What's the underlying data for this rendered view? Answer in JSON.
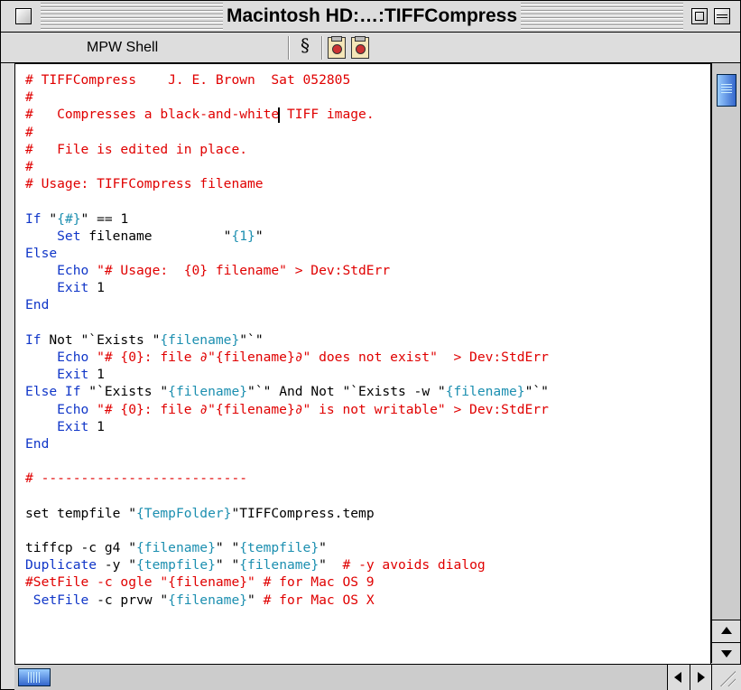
{
  "window": {
    "title": "Macintosh HD:…:TIFFCompress"
  },
  "infobar": {
    "shell_label": "MPW Shell",
    "section_glyph": "§",
    "icons": [
      "script-tool-icon",
      "script-tool-icon"
    ]
  },
  "colors": {
    "comment": "#e00000",
    "keyword": "#1036c8",
    "variable": "#1c8fb0",
    "text": "#000000",
    "scroll_thumb": "#3366cc"
  },
  "code_lines": [
    [
      [
        "c-red",
        "# TIFFCompress    J. E. Brown  Sat 052805"
      ]
    ],
    [
      [
        "c-red",
        "#"
      ]
    ],
    [
      [
        "c-red",
        "#   Compresses a black-and-white"
      ],
      [
        "caret",
        ""
      ],
      [
        "c-red",
        " TIFF image."
      ]
    ],
    [
      [
        "c-red",
        "#"
      ]
    ],
    [
      [
        "c-red",
        "#   File is edited in place."
      ]
    ],
    [
      [
        "c-red",
        "#"
      ]
    ],
    [
      [
        "c-red",
        "# Usage: TIFFCompress filename"
      ]
    ],
    [],
    [
      [
        "c-blue",
        "If "
      ],
      [
        "c-black",
        "\""
      ],
      [
        "c-teal",
        "{#}"
      ],
      [
        "c-black",
        "\" == 1"
      ]
    ],
    [
      [
        "c-blue",
        "    Set "
      ],
      [
        "c-black",
        "filename         \""
      ],
      [
        "c-teal",
        "{1}"
      ],
      [
        "c-black",
        "\""
      ]
    ],
    [
      [
        "c-blue",
        "Else"
      ]
    ],
    [
      [
        "c-blue",
        "    Echo "
      ],
      [
        "c-red",
        "\"# Usage:  {0} filename\" > Dev:StdErr"
      ]
    ],
    [
      [
        "c-blue",
        "    Exit "
      ],
      [
        "c-black",
        "1"
      ]
    ],
    [
      [
        "c-blue",
        "End"
      ]
    ],
    [],
    [
      [
        "c-blue",
        "If "
      ],
      [
        "c-black",
        "Not \"`Exists \""
      ],
      [
        "c-teal",
        "{filename}"
      ],
      [
        "c-black",
        "\"`\""
      ]
    ],
    [
      [
        "c-blue",
        "    Echo "
      ],
      [
        "c-red",
        "\"# {0}: file ∂\"{filename}∂\" does not exist\"  > Dev:StdErr"
      ]
    ],
    [
      [
        "c-blue",
        "    Exit "
      ],
      [
        "c-black",
        "1"
      ]
    ],
    [
      [
        "c-blue",
        "Else If "
      ],
      [
        "c-black",
        "\"`Exists \""
      ],
      [
        "c-teal",
        "{filename}"
      ],
      [
        "c-black",
        "\"`\" And Not \"`Exists -w \""
      ],
      [
        "c-teal",
        "{filename}"
      ],
      [
        "c-black",
        "\"`\""
      ]
    ],
    [
      [
        "c-blue",
        "    Echo "
      ],
      [
        "c-red",
        "\"# {0}: file ∂\"{filename}∂\" is not writable\" > Dev:StdErr"
      ]
    ],
    [
      [
        "c-blue",
        "    Exit "
      ],
      [
        "c-black",
        "1"
      ]
    ],
    [
      [
        "c-blue",
        "End"
      ]
    ],
    [],
    [
      [
        "c-red",
        "# --------------------------"
      ]
    ],
    [],
    [
      [
        "c-black",
        "set tempfile \""
      ],
      [
        "c-teal",
        "{TempFolder}"
      ],
      [
        "c-black",
        "\"TIFFCompress.temp"
      ]
    ],
    [],
    [
      [
        "c-black",
        "tiffcp -c g4 \""
      ],
      [
        "c-teal",
        "{filename}"
      ],
      [
        "c-black",
        "\" \""
      ],
      [
        "c-teal",
        "{tempfile}"
      ],
      [
        "c-black",
        "\""
      ]
    ],
    [
      [
        "c-blue",
        "Duplicate "
      ],
      [
        "c-black",
        "-y \""
      ],
      [
        "c-teal",
        "{tempfile}"
      ],
      [
        "c-black",
        "\" \""
      ],
      [
        "c-teal",
        "{filename}"
      ],
      [
        "c-black",
        "\"  "
      ],
      [
        "c-red",
        "# -y avoids dialog"
      ]
    ],
    [
      [
        "c-red",
        "#SetFile -c ogle \"{filename}\" # for Mac OS 9"
      ]
    ],
    [
      [
        "c-blue",
        " SetFile "
      ],
      [
        "c-black",
        "-c prvw \""
      ],
      [
        "c-teal",
        "{filename}"
      ],
      [
        "c-black",
        "\" "
      ],
      [
        "c-red",
        "# for Mac OS X"
      ]
    ]
  ]
}
